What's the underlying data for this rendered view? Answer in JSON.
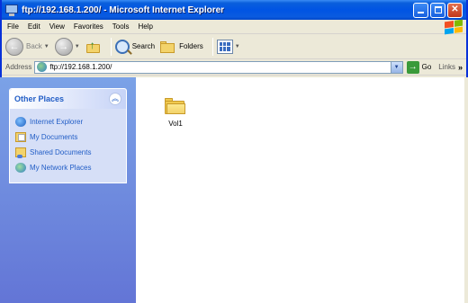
{
  "window": {
    "title": "ftp://192.168.1.200/ - Microsoft Internet Explorer"
  },
  "menu": [
    "File",
    "Edit",
    "View",
    "Favorites",
    "Tools",
    "Help"
  ],
  "toolbar": {
    "back_label": "Back",
    "search_label": "Search",
    "folders_label": "Folders"
  },
  "address": {
    "label": "Address",
    "value": "ftp://192.168.1.200/",
    "go_label": "Go",
    "links_label": "Links"
  },
  "taskpane": {
    "title": "Other Places",
    "items": [
      {
        "label": "Internet Explorer",
        "icon": "internet-explorer-icon"
      },
      {
        "label": "My Documents",
        "icon": "my-documents-icon"
      },
      {
        "label": "Shared Documents",
        "icon": "shared-documents-icon"
      },
      {
        "label": "My Network Places",
        "icon": "network-places-icon"
      }
    ]
  },
  "files": [
    {
      "name": "Vol1",
      "icon": "folder-icon"
    }
  ]
}
